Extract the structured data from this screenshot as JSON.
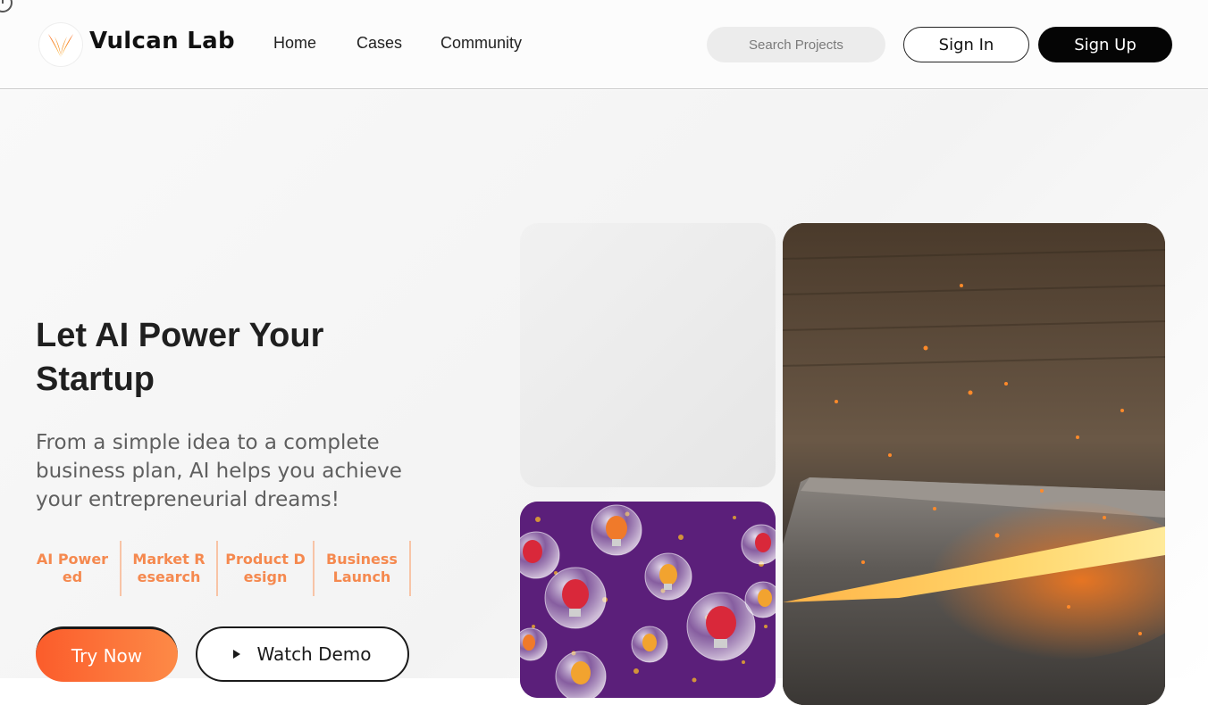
{
  "header": {
    "brand": "Vulcan Lab",
    "nav": [
      "Home",
      "Cases",
      "Community"
    ],
    "search_placeholder": "Search Projects",
    "signin_label": "Sign In",
    "signup_label": "Sign Up"
  },
  "hero": {
    "title": "Let AI Power Your Startup",
    "subtitle": "From a simple idea to a complete business plan, AI helps you achieve your entrepreneurial dreams!",
    "tags": [
      "AI Powered",
      "Market Research",
      "Product Design",
      "Business Launch"
    ],
    "try_label": "Try Now",
    "demo_label": "Watch Demo"
  },
  "icons": {
    "logo": "flame-logo-icon",
    "demo": "play-icon"
  },
  "colors": {
    "accent": "#fb5c2b",
    "accent_light": "#f5894f",
    "signup_bg": "#050505",
    "bulbs_bg": "#5b1f7a"
  }
}
